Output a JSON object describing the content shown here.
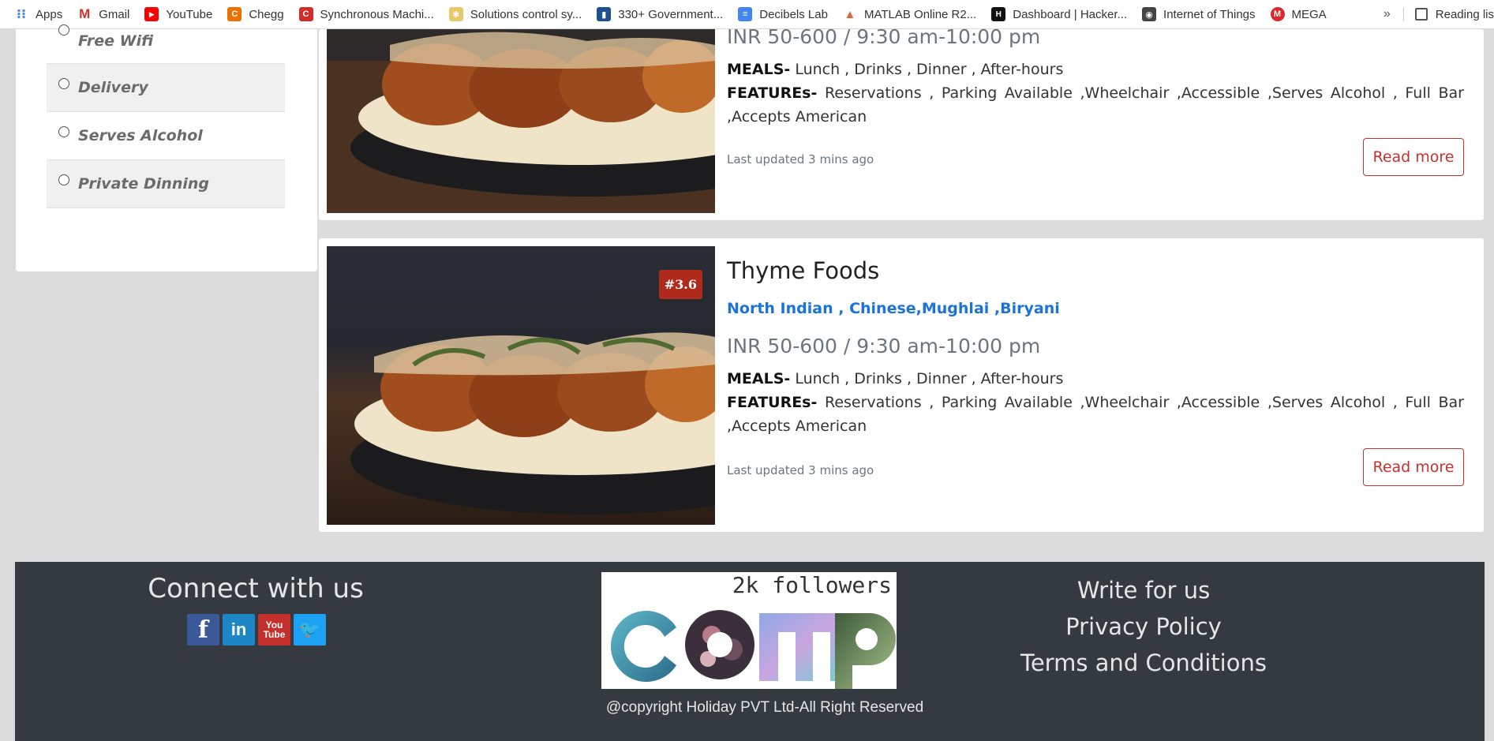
{
  "bookmarks": {
    "items": [
      {
        "label": "Apps",
        "icon": "apps-grid-icon",
        "color": "#4285f4"
      },
      {
        "label": "Gmail",
        "icon": "gmail-icon",
        "color": "#d93025"
      },
      {
        "label": "YouTube",
        "icon": "youtube-icon",
        "color": "#ff0000"
      },
      {
        "label": "Chegg",
        "icon": "chegg-icon",
        "color": "#eb7100"
      },
      {
        "label": "Synchronous Machi...",
        "icon": "c-logo-icon",
        "color": "#d42b2b"
      },
      {
        "label": "Solutions control sy...",
        "icon": "puzzle-icon",
        "color": "#7aa7e0"
      },
      {
        "label": "330+ Government...",
        "icon": "bookmark-site-icon",
        "color": "#1d4f91"
      },
      {
        "label": "Decibels Lab",
        "icon": "docs-icon",
        "color": "#4285f4"
      },
      {
        "label": "MATLAB Online R2...",
        "icon": "matlab-icon",
        "color": "#e16737"
      },
      {
        "label": "Dashboard | Hacker...",
        "icon": "hackerrank-icon",
        "color": "#111111"
      },
      {
        "label": "Internet of Things",
        "icon": "classroom-icon",
        "color": "#444444"
      },
      {
        "label": "MEGA",
        "icon": "mega-icon",
        "color": "#d9272e"
      }
    ],
    "more": "»",
    "reading_list": "Reading lis"
  },
  "sidebar": {
    "filters": [
      {
        "label": "Free Wifi"
      },
      {
        "label": "Delivery"
      },
      {
        "label": "Serves Alcohol"
      },
      {
        "label": "Private Dinning"
      }
    ]
  },
  "listings": [
    {
      "price_hours": "INR 50-600 / 9:30 am-10:00 pm",
      "meals_label": "MEALS-",
      "meals": " Lunch , Drinks , Dinner , After-hours",
      "features_label": "FEATUREs-",
      "features": " Reservations , Parking Available ,Wheelchair ,Accessible ,Serves Alcohol , Full Bar ,Accepts American",
      "updated": "Last updated 3 mins ago",
      "read_more": "Read more"
    },
    {
      "rating": "#3.6",
      "name": "Thyme Foods",
      "cuisines": [
        "North Indian",
        "Chinese",
        "Mughlai",
        "Biryani"
      ],
      "cuisine_sep1": " , ",
      "cuisine_sep2": ",",
      "cuisine_sep3": " ,",
      "price_hours": "INR 50-600 / 9:30 am-10:00 pm",
      "meals_label": "MEALS-",
      "meals": " Lunch , Drinks , Dinner , After-hours",
      "features_label": "FEATUREs-",
      "features": " Reservations , Parking Available ,Wheelchair ,Accessible ,Serves Alcohol , Full Bar ,Accepts American",
      "updated": "Last updated 3 mins ago",
      "read_more": "Read more"
    }
  ],
  "footer": {
    "connect_title": "Connect with us",
    "socials": [
      {
        "name": "facebook",
        "glyph": "f"
      },
      {
        "name": "linkedin",
        "glyph": "in"
      },
      {
        "name": "youtube",
        "glyph_top": "You",
        "glyph_bottom": "Tube"
      },
      {
        "name": "twitter",
        "glyph": "🐦"
      }
    ],
    "logo_followers": "2k followers",
    "logo_word": "comp",
    "links": [
      "Write for us",
      "Privacy Policy",
      "Terms and Conditions"
    ],
    "copyright": "@copyright Holiday PVT Ltd-All Right Reserved"
  }
}
